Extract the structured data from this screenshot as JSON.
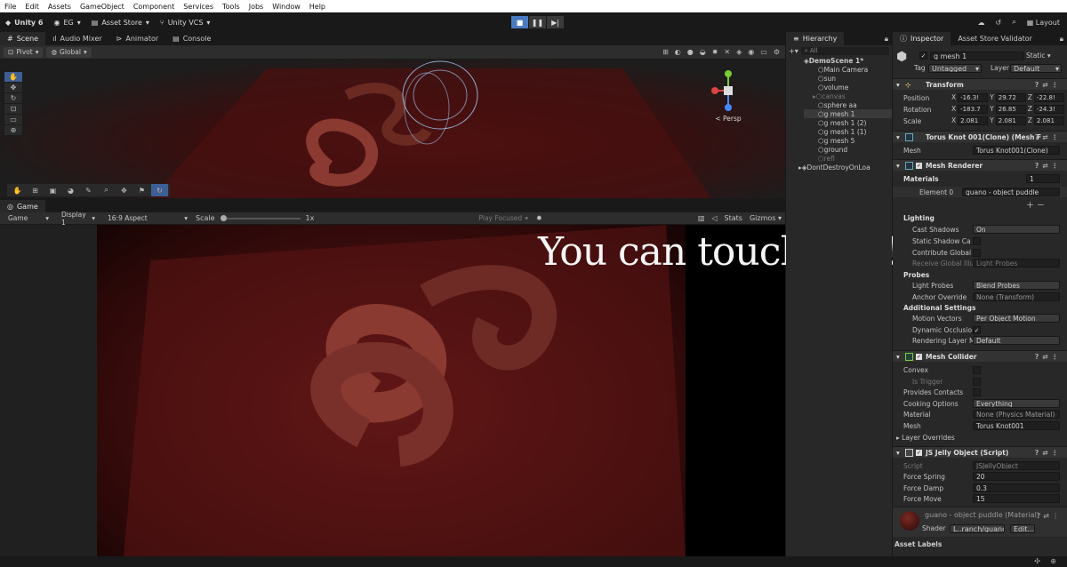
{
  "menu": [
    "File",
    "Edit",
    "Assets",
    "GameObject",
    "Component",
    "Services",
    "Tools",
    "Jobs",
    "Window",
    "Help"
  ],
  "toolbar": {
    "unity": "Unity 6",
    "account": "EG",
    "asset_store": "Asset Store",
    "vcs": "Unity VCS",
    "layout": "Layout"
  },
  "scene": {
    "tabs": [
      "Scene",
      "Audio Mixer",
      "Animator",
      "Console"
    ],
    "pivot": "Pivot",
    "global": "Global",
    "persp": "< Persp"
  },
  "game": {
    "tab": "Game",
    "mode": "Game",
    "display": "Display 1",
    "aspect": "16:9 Aspect",
    "scale_label": "Scale",
    "scale_value": "1x",
    "play_focused": "Play Focused",
    "stats": "Stats",
    "gizmos": "Gizmos"
  },
  "overlay_text": "You can touch this!!!",
  "hierarchy": {
    "title": "Hierarchy",
    "search": "All",
    "scene": "DemoScene 1*",
    "items": [
      "Main Camera",
      "sun",
      "volume",
      "canvas",
      "sphere aa",
      "g mesh 1",
      "g mesh 1 (2)",
      "g mesh 1 (1)",
      "g mesh 5",
      "ground",
      "refl"
    ],
    "ddol": "DontDestroyOnLoa"
  },
  "inspector": {
    "tabs": [
      "Inspector",
      "Asset Store Validator"
    ],
    "object_name": "g mesh 1",
    "static": "Static",
    "tag_label": "Tag",
    "tag": "Untagged",
    "layer_label": "Layer",
    "layer": "Default",
    "transform": {
      "title": "Transform",
      "position": {
        "label": "Position",
        "x": "-16.3!",
        "y": "29.72",
        "z": "-22.8!"
      },
      "rotation": {
        "label": "Rotation",
        "x": "-183.7",
        "y": "26.85",
        "z": "-24.3!"
      },
      "scale": {
        "label": "Scale",
        "x": "2.081",
        "y": "2.081",
        "z": "2.081"
      }
    },
    "mesh_filter": {
      "title": "Torus Knot 001(Clone) (Mesh F",
      "mesh_label": "Mesh",
      "mesh": "Torus Knot001(Clone)"
    },
    "mesh_renderer": {
      "title": "Mesh Renderer",
      "materials": "Materials",
      "count": "1",
      "element": "Element 0",
      "material": "guano - object puddle",
      "lighting": "Lighting",
      "cast_shadows_label": "Cast Shadows",
      "cast_shadows": "On",
      "static_shadow": "Static Shadow Ca",
      "contribute_gi": "Contribute Global",
      "receive_gi": "Receive Global Illu",
      "receive_gi_value": "Light Probes",
      "probes": "Probes",
      "light_probes_label": "Light Probes",
      "light_probes": "Blend Probes",
      "anchor_label": "Anchor Override",
      "anchor": "None (Transform)",
      "additional": "Additional Settings",
      "motion_label": "Motion Vectors",
      "motion": "Per Object Motion",
      "dynamic_occ": "Dynamic Occlusio",
      "rendering_layer_label": "Rendering Layer M",
      "rendering_layer": "Default"
    },
    "mesh_collider": {
      "title": "Mesh Collider",
      "convex": "Convex",
      "is_trigger": "Is Trigger",
      "provides": "Provides Contacts",
      "cooking_label": "Cooking Options",
      "cooking": "Everything",
      "material_label": "Material",
      "material": "None (Physics Material)",
      "mesh_label": "Mesh",
      "mesh": "Torus Knot001",
      "overrides": "Layer Overrides"
    },
    "jelly": {
      "title": "JS Jelly Object (Script)",
      "script_label": "Script",
      "script": "JSJellyObject",
      "spring_label": "Force Spring",
      "spring": "20",
      "damp_label": "Force Damp",
      "damp": "0.3",
      "move_label": "Force Move",
      "move": "15"
    },
    "material_footer": {
      "name": "guano - object puddle (Material)",
      "shader_label": "Shader",
      "shader": "L..ranch/guanc",
      "edit": "Edit..."
    },
    "asset_labels": "Asset Labels"
  },
  "colors": {
    "accent": "#3d5f96",
    "bg": "#282828"
  }
}
